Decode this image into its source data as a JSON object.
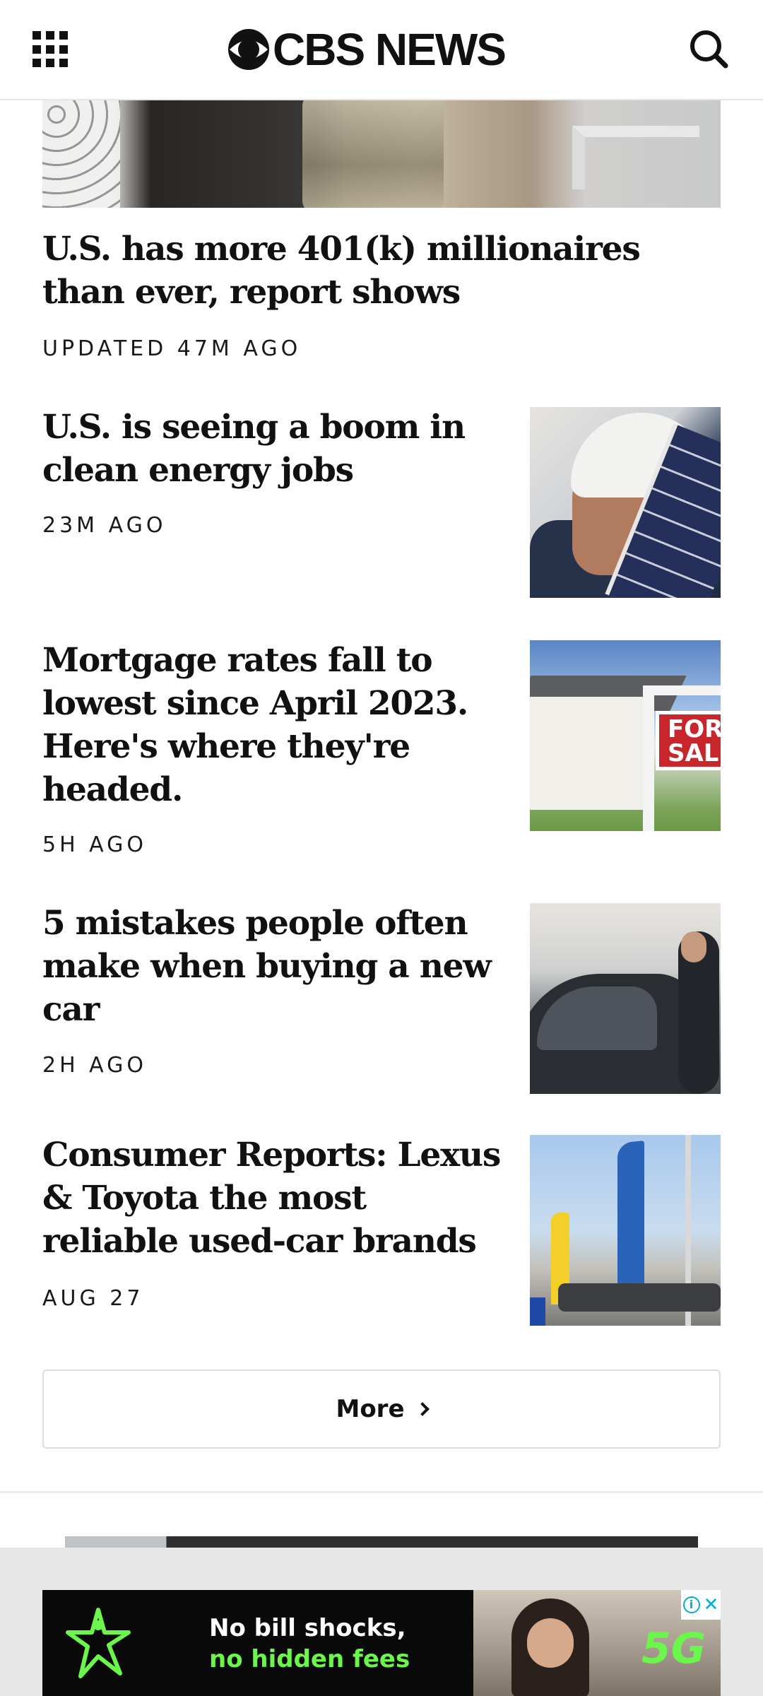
{
  "header": {
    "logo_text": "CBS NEWS",
    "menu_icon": "grid-menu-icon",
    "search_icon": "search-icon"
  },
  "articles": [
    {
      "headline": "U.S. has more 401(k) millionaires than ever, report shows",
      "meta": "UPDATED 47M AGO"
    },
    {
      "headline": "U.S. is seeing a boom in clean energy jobs",
      "meta": "23M AGO"
    },
    {
      "headline": "Mortgage rates fall to lowest since April 2023. Here's where they're headed.",
      "meta": "5H AGO",
      "thumb_sign": "FOR SALE"
    },
    {
      "headline": "5 mistakes people often make when buying a new car",
      "meta": "2H AGO"
    },
    {
      "headline": "Consumer Reports: Lexus & Toyota the most reliable used-car brands",
      "meta": "AUG 27"
    }
  ],
  "more_button": {
    "label": "More"
  },
  "ad": {
    "line1": "No bill shocks,",
    "line2": "no hidden fees",
    "badge": "5G",
    "info_label": "i",
    "close_label": "✕",
    "accent_color": "#6cf54a"
  }
}
